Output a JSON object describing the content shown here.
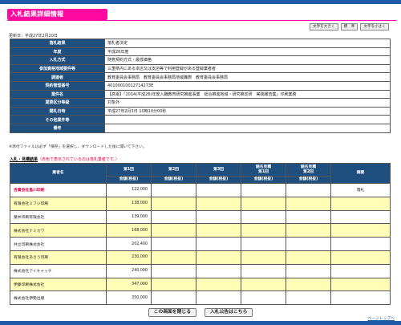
{
  "page": {
    "title": "入札結果詳細情報",
    "updated": "更新日：平成27年2月20日"
  },
  "font_buttons": [
    "文字を大きく",
    "標　準",
    "文字を小さく"
  ],
  "info_rows": [
    {
      "label": "落札結果",
      "value": "落札者決定"
    },
    {
      "label": "年度",
      "value": "平成26年度"
    },
    {
      "label": "入札方式",
      "value": "随意契約方式・最低価格"
    },
    {
      "label": "参加資格地域要件等",
      "value": "三重県内にある本店又は支店等で利用登録がある登録業者者"
    },
    {
      "label": "調達者",
      "value": "教育委員会事務局　教育委員会事務局地域職際　教育委員会事務局"
    },
    {
      "label": "契約管理番号",
      "value": "40100010012714273E"
    },
    {
      "label": "業件名",
      "value": "【高電】「2014(平成26)年度入職教育研究推進事業　総合推進地域・研究推定研　実践報告集」印刷業務"
    },
    {
      "label": "業務区分等級",
      "value": "対象外"
    },
    {
      "label": "開札日時",
      "value": "平成27年2月3日 10時10分00秒"
    },
    {
      "label": "その他業件等",
      "value": ""
    },
    {
      "label": "備考",
      "value": ""
    }
  ],
  "note": "※添付ファイルは必ず「保存」を選択し、ダウンロードした後に開いて下さい。",
  "bids_section": {
    "title": "入札・見積結果",
    "sub": "（赤色で表示されているのは落札業者です。）"
  },
  "bids_headers": {
    "company": "業者名",
    "r1": "第1回",
    "r2": "第2回",
    "r3": "第3回",
    "n1": "随名見積\n第1回",
    "n2": "随名見積\n第2回",
    "remark": "摘要",
    "amount": "金額(税抜)"
  },
  "bids": [
    {
      "name": "合資会社島川印刷",
      "r1": "122,000",
      "remark": "落札",
      "winner": true
    },
    {
      "name": "有限会社ミフジ印刷",
      "r1": "138,000",
      "remark": "",
      "winner": false
    },
    {
      "name": "葉井印刷有限会社",
      "r1": "139,000",
      "remark": "",
      "winner": false
    },
    {
      "name": "株式会社ナミカワ",
      "r1": "168,000",
      "remark": "",
      "winner": false
    },
    {
      "name": "共立印刷株式会社",
      "r1": "202,400",
      "remark": "",
      "winner": false
    },
    {
      "name": "有限会社あさう印刷",
      "r1": "230,000",
      "remark": "",
      "winner": false
    },
    {
      "name": "株式会社アイキャッチ",
      "r1": "240,000",
      "remark": "",
      "winner": false
    },
    {
      "name": "伊藤印刷株式会社",
      "r1": "347,000",
      "remark": "",
      "winner": false
    },
    {
      "name": "株式会社伊勢出版",
      "r1": "350,000",
      "remark": "",
      "winner": false
    }
  ],
  "buttons": {
    "close": "この画面を閉じる",
    "notice": "入札公告はこちら"
  },
  "pagetop": "ページトップへ"
}
